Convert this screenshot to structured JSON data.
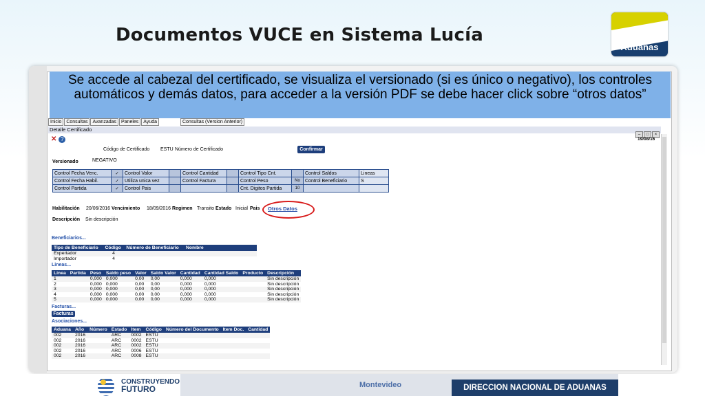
{
  "slide": {
    "title": "Documentos VUCE en Sistema Lucía",
    "logo_text": "Aduanas",
    "caption": "Se accede al cabezal del certificado, se visualiza el versionado (si es único o negativo), los controles automáticos y demás datos, para acceder a la versión PDF se debe hacer click sobre “otros datos”"
  },
  "app": {
    "menu": [
      "Inicio",
      "Consultas",
      "Avanzadas",
      "Paneles",
      "Ayuda",
      "Consultas (Version Anterior)"
    ],
    "window_title": "Detalle Certificado",
    "date": "19/08/16",
    "codigo_label": "Código de Certificado",
    "codigo_value": "ESTU",
    "numero_label": "Número de Certificado",
    "confirm_label": "Confirmar",
    "versionado_label": "Versionado",
    "versionado_value": "NEGATIVO",
    "controls": [
      [
        {
          "label": "Control Fecha Venc.",
          "check": "✓"
        },
        {
          "label": "Control Valor",
          "check": ""
        },
        {
          "label": "Control Cantidad",
          "check": ""
        },
        {
          "label": "Control Tipo Cnt.",
          "check": ""
        },
        {
          "label": "Control Saldos",
          "value": "Lineas"
        }
      ],
      [
        {
          "label": "Control Fecha Habil.",
          "check": "✓"
        },
        {
          "label": "Utiliza unica vez",
          "check": ""
        },
        {
          "label": "Control Factura",
          "check": ""
        },
        {
          "label": "Control Peso",
          "check": "No"
        },
        {
          "label": "Control Beneficiario",
          "value": "S"
        }
      ],
      [
        {
          "label": "Control Partida",
          "check": "✓"
        },
        {
          "label": "Control Pais",
          "check": ""
        },
        {
          "label": "",
          "check": ""
        },
        {
          "label": "Cnt. Digitos Partida",
          "check": "10"
        },
        {
          "label": "",
          "value": ""
        }
      ]
    ],
    "habilitacion_label": "Habilitación",
    "habilitacion_value": "20/06/2016",
    "vencimiento_label": "Vencimiento",
    "vencimiento_value": "18/09/2016",
    "regimen_label": "Regimen",
    "regimen_value": "Transito",
    "estado_label": "Estado",
    "estado_value": "Inicial",
    "pais_label": "Pais",
    "otros_datos": "Otros Datos",
    "descripcion_label": "Descripción",
    "descripcion_value": "Sin descripción",
    "beneficiarios_title": "Beneficiarios...",
    "beneficiarios_headers": [
      "Tipo de Beneficiario",
      "Código",
      "Número de Beneficiario",
      "Nombre"
    ],
    "beneficiarios_rows": [
      [
        "Expertador",
        "4",
        "",
        ""
      ],
      [
        "Importador",
        "4",
        "",
        ""
      ]
    ],
    "lineas_title": "Lineas...",
    "lineas_headers": [
      "Linea",
      "Partida",
      "Peso",
      "Saldo peso",
      "Valor",
      "Saldo Valor",
      "Cantidad",
      "Cantidad Saldo",
      "Producto",
      "Descripción"
    ],
    "lineas_rows": [
      [
        "1",
        "",
        "0,000",
        "0,000",
        "0,00",
        "0,00",
        "0,000",
        "0,000",
        "",
        "Sin descripción"
      ],
      [
        "2",
        "",
        "0,000",
        "0,000",
        "0,00",
        "0,00",
        "0,000",
        "0,000",
        "",
        "Sin descripción"
      ],
      [
        "3",
        "",
        "0,000",
        "0,000",
        "0,00",
        "0,00",
        "0,000",
        "0,000",
        "",
        "Sin descripción"
      ],
      [
        "4",
        "",
        "0,000",
        "0,000",
        "0,00",
        "0,00",
        "0,000",
        "0,000",
        "",
        "Sin descripción"
      ],
      [
        "5",
        "",
        "0,000",
        "0,000",
        "0,00",
        "0,00",
        "0,000",
        "0,000",
        "",
        "Sin descripción"
      ]
    ],
    "facturas_title": "Facturas...",
    "facturas_button": "Facturas",
    "asociaciones_title": "Asociaciones...",
    "asociaciones_headers": [
      "Aduana",
      "Año",
      "Número",
      "Estado",
      "Item",
      "Código",
      "Número del Documento",
      "Item Doc.",
      "Cantidad"
    ],
    "asociaciones_rows": [
      [
        "002",
        "2016",
        "",
        "ARC",
        "0002",
        "ESTU",
        "",
        "",
        ""
      ],
      [
        "002",
        "2016",
        "",
        "ARC",
        "0002",
        "ESTU",
        "",
        "",
        ""
      ],
      [
        "002",
        "2016",
        "",
        "ARC",
        "0002",
        "ESTU",
        "",
        "",
        ""
      ],
      [
        "002",
        "2016",
        "",
        "ARC",
        "0006",
        "ESTU",
        "",
        "",
        ""
      ],
      [
        "002",
        "2016",
        "",
        "ARC",
        "0008",
        "ESTU",
        "",
        "",
        ""
      ]
    ]
  },
  "footer": {
    "brand_line1": "CONSTRUYENDO",
    "brand_line2": "FUTURO",
    "city": "Montevideo",
    "agency": "DIRECCION NACIONAL DE ADUANAS"
  }
}
